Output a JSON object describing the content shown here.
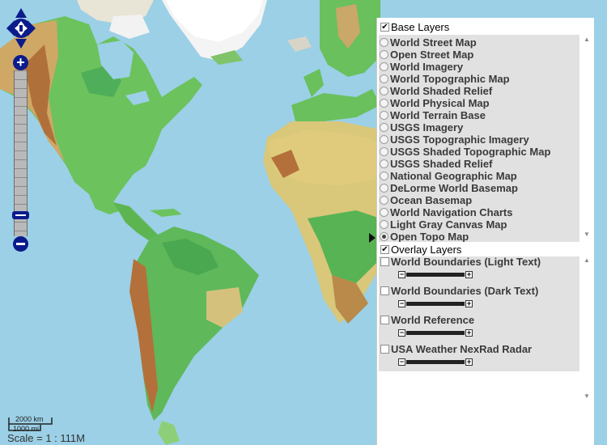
{
  "map": {
    "scale_km": "2000 km",
    "scale_mi": "1000 mi",
    "scale_ratio": "Scale = 1 : 111M"
  },
  "zoom": {
    "plus": "+",
    "minus": "−"
  },
  "base_layers": {
    "title": "Base Layers",
    "checked": true,
    "items": [
      {
        "label": "World Street Map",
        "selected": false
      },
      {
        "label": "Open Street Map",
        "selected": false
      },
      {
        "label": "World Imagery",
        "selected": false
      },
      {
        "label": "World Topographic Map",
        "selected": false
      },
      {
        "label": "World Shaded Relief",
        "selected": false
      },
      {
        "label": "World Physical Map",
        "selected": false
      },
      {
        "label": "World Terrain Base",
        "selected": false
      },
      {
        "label": "USGS Imagery",
        "selected": false
      },
      {
        "label": "USGS Topographic Imagery",
        "selected": false
      },
      {
        "label": "USGS Shaded Topographic Map",
        "selected": false
      },
      {
        "label": "USGS Shaded Relief",
        "selected": false
      },
      {
        "label": "National Geographic Map",
        "selected": false
      },
      {
        "label": "DeLorme World Basemap",
        "selected": false
      },
      {
        "label": "Ocean Basemap",
        "selected": false
      },
      {
        "label": "World Navigation Charts",
        "selected": false
      },
      {
        "label": "Light Gray Canvas Map",
        "selected": false
      },
      {
        "label": "Open Topo Map",
        "selected": true
      }
    ]
  },
  "overlay_layers": {
    "title": "Overlay Layers",
    "checked": true,
    "items": [
      {
        "label": "World Boundaries (Light Text)",
        "checked": false
      },
      {
        "label": "World Boundaries (Dark Text)",
        "checked": false
      },
      {
        "label": "World Reference",
        "checked": false
      },
      {
        "label": "USA Weather NexRad Radar",
        "checked": false
      }
    ]
  },
  "opacity": {
    "minus": "−",
    "plus": "+"
  },
  "colors": {
    "ocean": "#9bd0e6",
    "lowland": "#5fb85a",
    "upland": "#d9c77a",
    "mountain": "#b8743a",
    "ice": "#ffffff",
    "control": "#0b1b8c"
  }
}
